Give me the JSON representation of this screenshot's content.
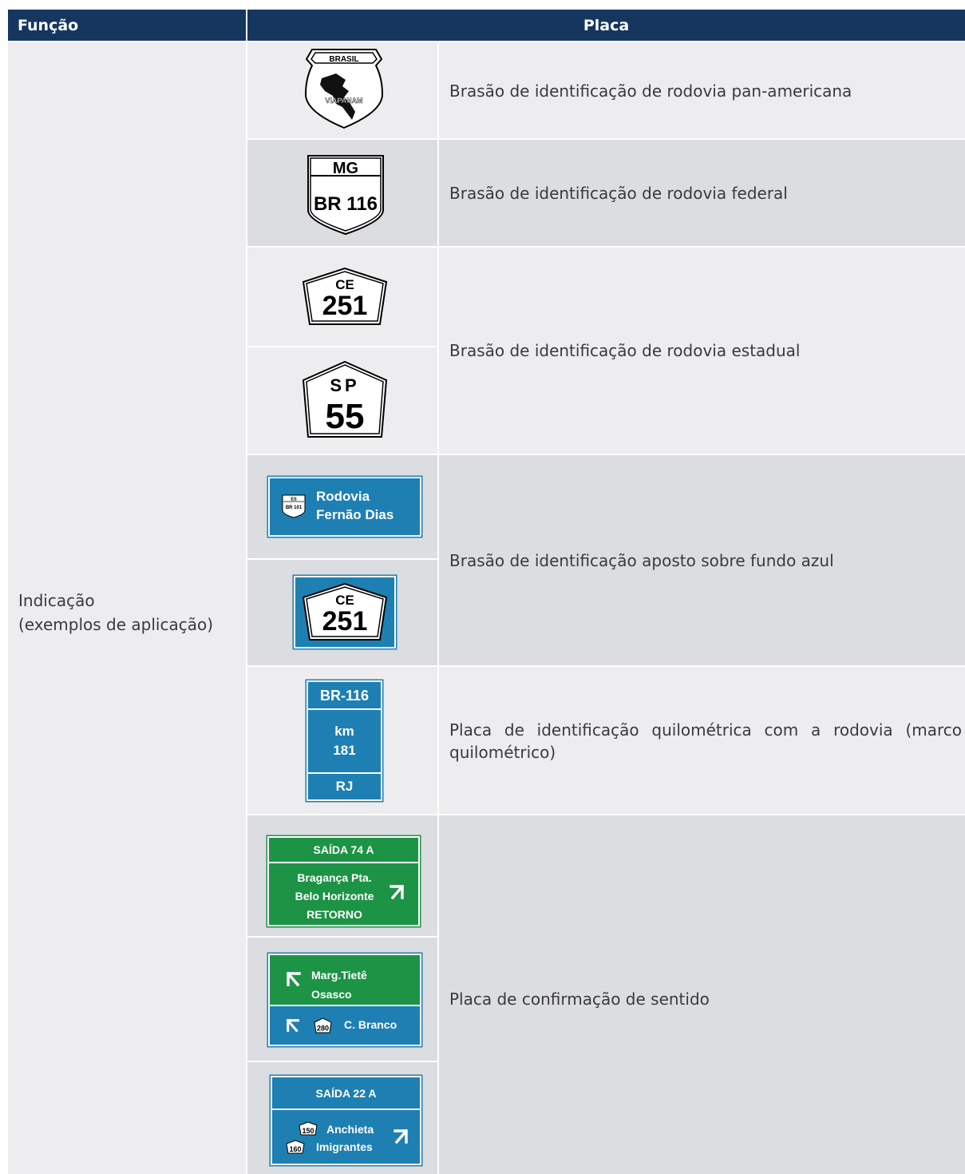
{
  "header": {
    "col1": "Função",
    "col2": "Placa"
  },
  "funcao": {
    "line1": "Indicação",
    "line2": "(exemplos de aplicação)"
  },
  "descriptions": {
    "pan": "Brasão de identificação de rodovia pan-americana",
    "federal": "Brasão de identificação de rodovia federal",
    "estadual": "Brasão de identificação de rodovia estadual",
    "azul": "Brasão de identificação aposto sobre fundo azul",
    "km": "Placa de identificação quilométrica com a rodovia (marco quilométrico)",
    "sentido": "Placa de confirmação de sentido"
  },
  "signs": {
    "pan": {
      "top": "BRASIL",
      "word": "VIAPANAM"
    },
    "federal": {
      "state": "MG",
      "road": "BR 116"
    },
    "ce": {
      "state": "CE",
      "number": "251"
    },
    "sp": {
      "state": "SP",
      "number": "55"
    },
    "fernao": {
      "shield_state": "ES",
      "shield_road": "BR 101",
      "line1": "Rodovia",
      "line2": "Fernão Dias"
    },
    "ce_blue": {
      "state": "CE",
      "number": "251"
    },
    "km": {
      "road": "BR-116",
      "km": "km",
      "value": "181",
      "state": "RJ"
    },
    "saida74": {
      "title": "SAÍDA 74 A",
      "line1": "Bragança Pta.",
      "line2": "Belo Horizonte",
      "line3": "RETORNO"
    },
    "tiete": {
      "line1": "Marg.Tietê",
      "line2": "Osasco",
      "shield": "280",
      "dest": "C. Branco"
    },
    "saida22": {
      "title": "SAÍDA 22 A",
      "shield1": "150",
      "dest1": "Anchieta",
      "shield2": "160",
      "dest2": "Imigrantes"
    }
  },
  "colors": {
    "header": "#15365f",
    "sign_blue": "#1e7fb3",
    "sign_green": "#1d9346"
  }
}
